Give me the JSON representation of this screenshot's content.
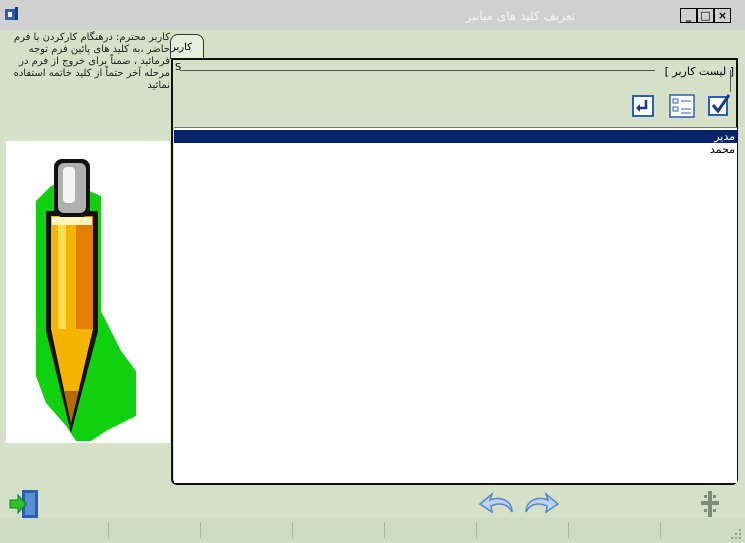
{
  "window": {
    "title": "تعریف کلید های میانبر",
    "minimize_glyph": "_",
    "maximize_glyph": "□",
    "close_glyph": "×"
  },
  "hint": {
    "text": "کاربر محترم: درهنگام کارکردن با فرم حاضر ،به کلید های پائین فرم توجه فرمائید ، ضمناً برای خروج از فرم در مرحله آخر حتماً از کلید خاتمه استفاده نمائید"
  },
  "tab": {
    "label": "کاربر"
  },
  "panel": {
    "group_label": "[ لیست کاربر ]",
    "side_letter": "S"
  },
  "toolbar": {
    "icons": [
      "enter-icon",
      "list-icon",
      "check-icon"
    ]
  },
  "users": {
    "rows": [
      {
        "label": "مدیر",
        "selected": true
      },
      {
        "label": "محمد",
        "selected": false
      }
    ]
  },
  "colors": {
    "background": "#d4e0c8",
    "selection": "#0a246a",
    "icon_blue": "#2a5fb8"
  }
}
